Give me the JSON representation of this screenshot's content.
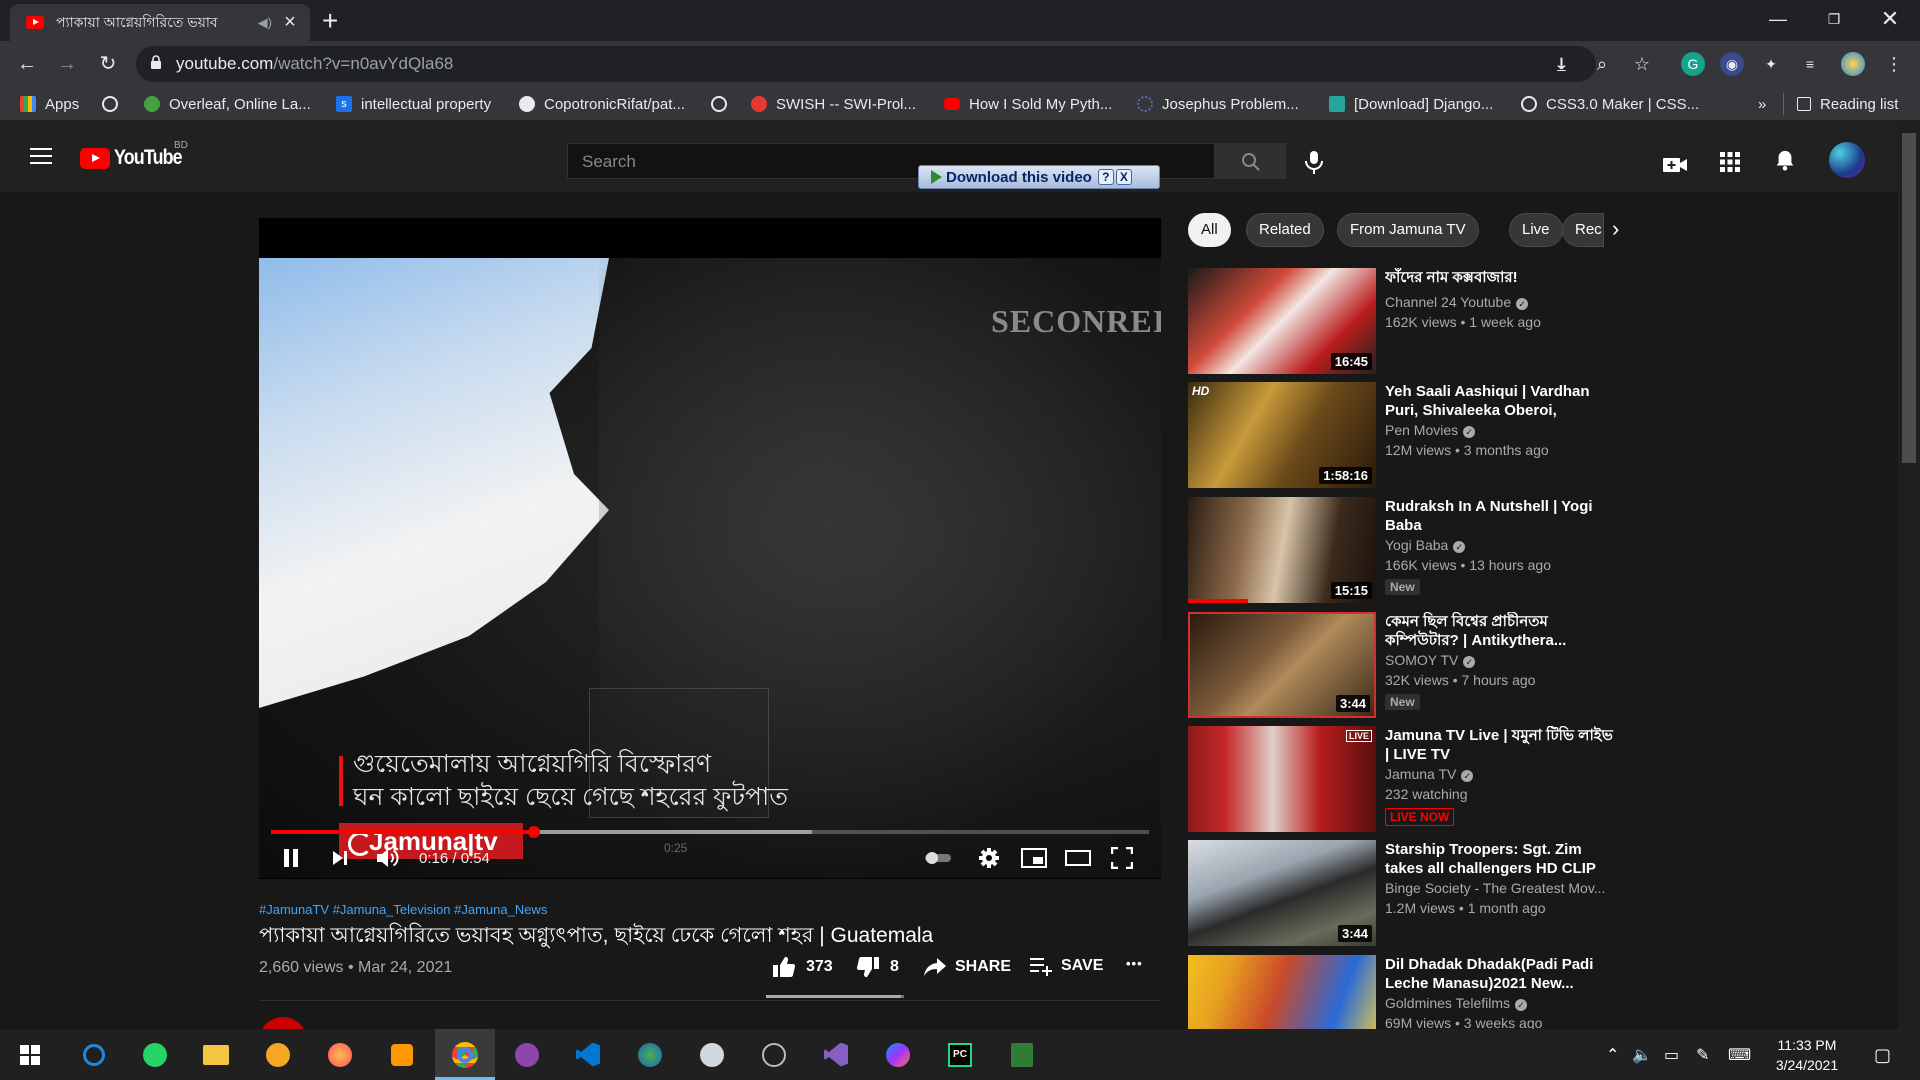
{
  "browser": {
    "tab_title": "প্যাকায়া আগ্নেয়গিরিতে ভয়াব",
    "url_host": "youtube.com",
    "url_path": "/watch?v=n0avYdQla68"
  },
  "bookmarks": [
    {
      "label": "Apps",
      "color": "#4285f4"
    },
    {
      "label": "",
      "color": "#e8eaed"
    },
    {
      "label": "Overleaf, Online La...",
      "color": "#47a141"
    },
    {
      "label": "intellectual property",
      "color": "#1a73e8"
    },
    {
      "label": "CopotronicRifat/pat...",
      "color": "#e8eaed"
    },
    {
      "label": "",
      "color": "#e8eaed"
    },
    {
      "label": "SWISH -- SWI-Prol...",
      "color": "#e53935"
    },
    {
      "label": "How I Sold My Pyth...",
      "color": "#ff0000"
    },
    {
      "label": "Josephus Problem...",
      "color": "#5c6bc0"
    },
    {
      "label": "[Download] Django...",
      "color": "#26a69a"
    },
    {
      "label": "CSS3.0 Maker | CSS...",
      "color": "#e8eaed"
    }
  ],
  "bookmarks_more": "»",
  "reading_list": "Reading list",
  "youtube": {
    "logo_text": "YouTube",
    "country_code": "BD",
    "search_placeholder": "Search",
    "download_button": "Download this video",
    "download_help": "?",
    "download_close": "X"
  },
  "player": {
    "overlay_text": "SECONREI",
    "lower_third_line1": "গুয়েতেমালায় আগ্নেয়গিরি বিস্ফোরণ",
    "lower_third_line2": "ঘন কালো ছাইয়ে ছেয়ে গেছে শহরের ফুটপাত",
    "channel_logo": "Jamuna|tv",
    "hover_time": "0:25",
    "time_display": "0:16 / 0:54",
    "played_fraction": 0.3,
    "loaded_fraction": 0.616
  },
  "video": {
    "hashtags": "#JamunaTV #Jamuna_Television #Jamuna_News",
    "title": "প্যাকায়া আগ্নেয়গিরিতে ভয়াবহ অগ্ন্যুৎপাত, ছাইয়ে ঢেকে গেলো শহর | Guatemala",
    "meta": "2,660 views • Mar 24, 2021",
    "likes": "373",
    "dislikes": "8",
    "share": "SHARE",
    "save": "SAVE",
    "more": "•••",
    "like_fraction": 0.98
  },
  "chips": [
    "All",
    "Related",
    "From Jamuna TV",
    "Live",
    "Rec"
  ],
  "recommendations": [
    {
      "title": "ফাঁদের নাম কক্সবাজার!",
      "channel": "Channel 24 Youtube",
      "meta": "162K views • 1 week ago",
      "duration": "16:45",
      "badge": ""
    },
    {
      "title": "Yeh Saali Aashiqui | Vardhan Puri, Shivaleeka Oberoi, Jesse...",
      "channel": "Pen Movies",
      "meta": "12M views • 3 months ago",
      "duration": "1:58:16",
      "badge": ""
    },
    {
      "title": "Rudraksh In A Nutshell | Yogi Baba",
      "channel": "Yogi Baba",
      "meta": "166K views • 13 hours ago",
      "duration": "15:15",
      "badge": "New"
    },
    {
      "title": "কেমন ছিল বিশ্বের প্রাচীনতম কম্পিউটার? | Antikythera...",
      "channel": "SOMOY TV",
      "meta": "32K views • 7 hours ago",
      "duration": "3:44",
      "badge": "New"
    },
    {
      "title": "Jamuna TV Live | যমুনা টিভি লাইভ | LIVE TV",
      "channel": "Jamuna TV",
      "meta": "232 watching",
      "duration": "",
      "badge": "LIVE NOW"
    },
    {
      "title": "Starship Troopers: Sgt. Zim takes all challengers HD CLIP",
      "channel": "Binge Society - The Greatest Mov...",
      "meta": "1.2M views • 1 month ago",
      "duration": "3:44",
      "badge": ""
    },
    {
      "title": "Dil Dhadak Dhadak(Padi Padi Leche Manasu)2021 New...",
      "channel": "Goldmines Telefilms",
      "meta": "69M views • 3 weeks ago",
      "duration": "",
      "badge": ""
    }
  ],
  "taskbar": {
    "time": "11:33 PM",
    "date": "3/24/2021"
  }
}
